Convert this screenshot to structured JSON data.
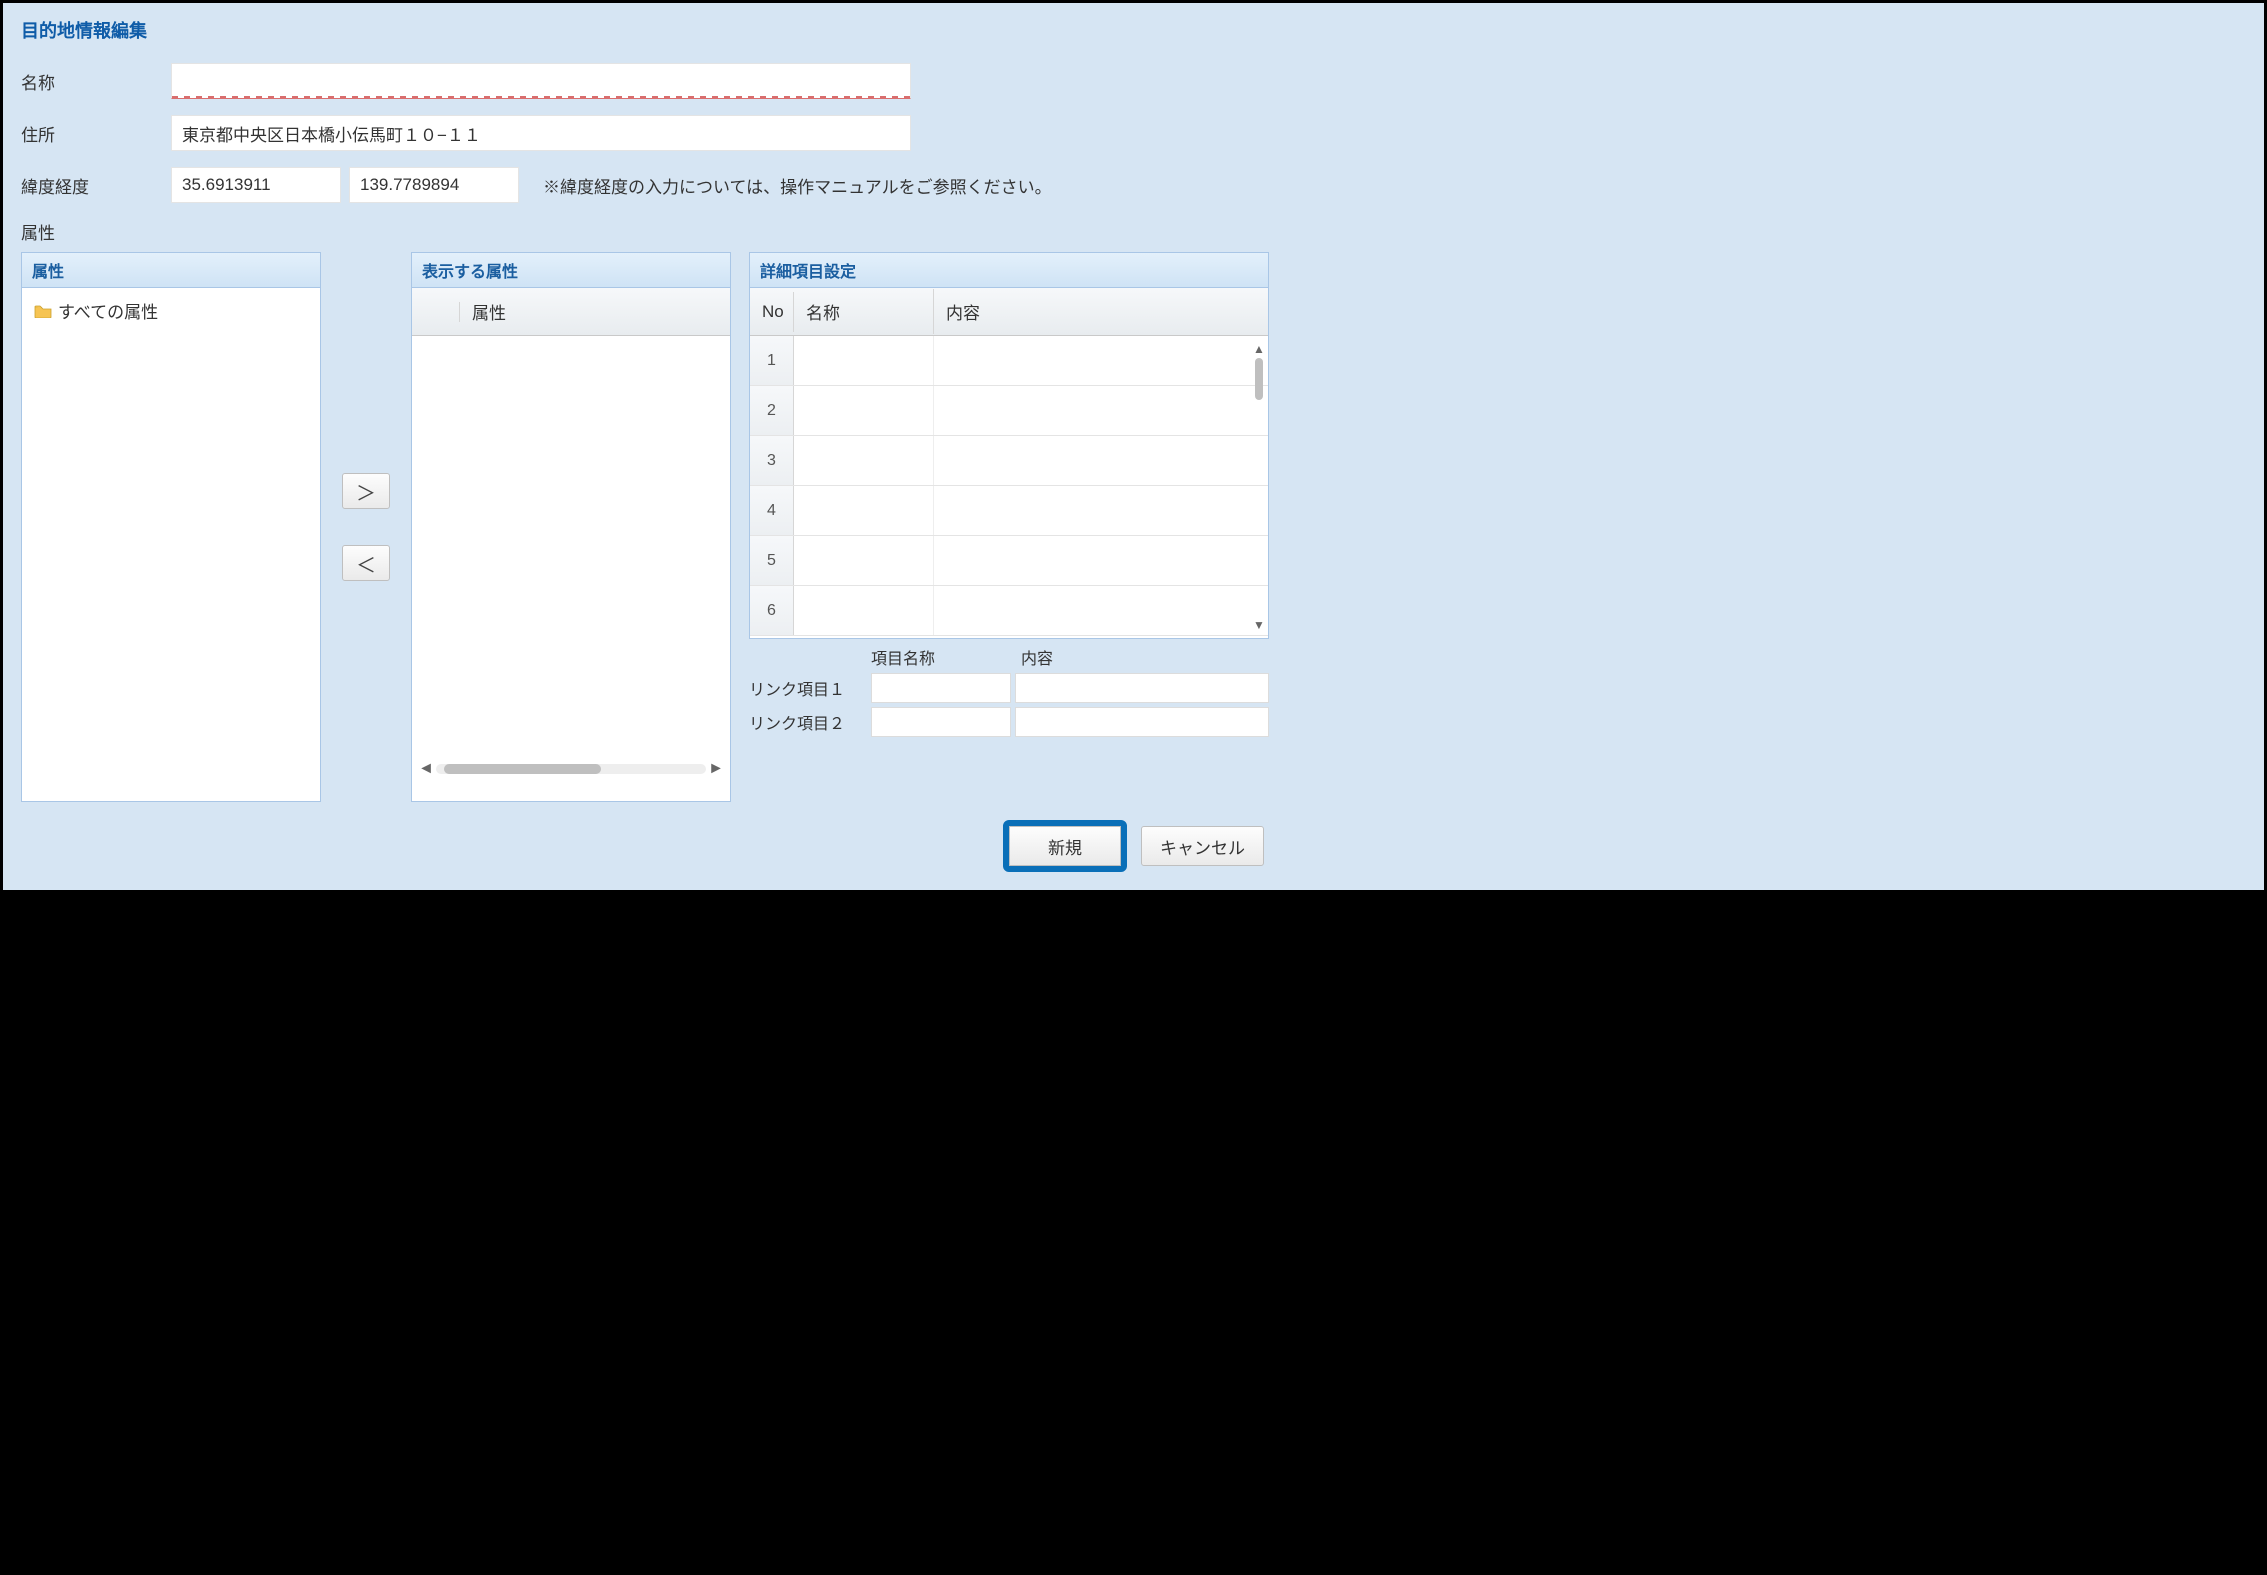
{
  "dialog": {
    "title": "目的地情報編集"
  },
  "form": {
    "name_label": "名称",
    "name_value": "",
    "address_label": "住所",
    "address_value": "東京都中央区日本橋小伝馬町１０−１１",
    "latlon_label": "緯度経度",
    "lat_value": "35.6913911",
    "lon_value": "139.7789894",
    "latlon_hint": "※緯度経度の入力については、操作マニュアルをご参照ください。",
    "attr_label": "属性"
  },
  "panels": {
    "attr_tree_title": "属性",
    "attr_tree_root": "すべての属性",
    "display_attr_title": "表示する属性",
    "display_attr_col": "属性",
    "detail_title": "詳細項目設定",
    "detail_cols": {
      "no": "No",
      "name": "名称",
      "content": "内容"
    },
    "detail_rows": [
      {
        "no": "1",
        "name": "",
        "content": ""
      },
      {
        "no": "2",
        "name": "",
        "content": ""
      },
      {
        "no": "3",
        "name": "",
        "content": ""
      },
      {
        "no": "4",
        "name": "",
        "content": ""
      },
      {
        "no": "5",
        "name": "",
        "content": ""
      },
      {
        "no": "6",
        "name": "",
        "content": ""
      }
    ]
  },
  "buttons": {
    "move_right": "＞",
    "move_left": "＜",
    "new": "新規",
    "cancel": "キャンセル"
  },
  "link": {
    "header_name": "項目名称",
    "header_content": "内容",
    "row1_label": "リンク項目１",
    "row1_name": "",
    "row1_content": "",
    "row2_label": "リンク項目２",
    "row2_name": "",
    "row2_content": ""
  }
}
